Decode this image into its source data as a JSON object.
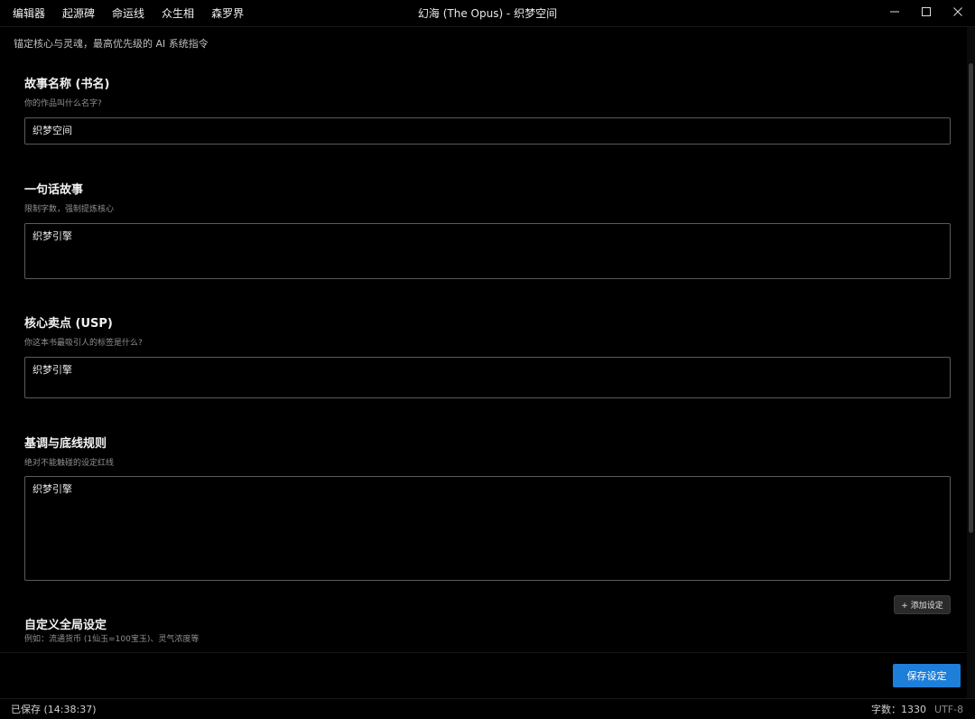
{
  "menu": [
    {
      "label": "编辑器"
    },
    {
      "label": "起源碑"
    },
    {
      "label": "命运线"
    },
    {
      "label": "众生相"
    },
    {
      "label": "森罗界"
    }
  ],
  "window": {
    "title": "幻海 (The Opus) - 织梦空间",
    "minimize_icon": "minimize-icon",
    "maximize_icon": "maximize-icon",
    "close_icon": "close-icon"
  },
  "page": {
    "subtitle": "锚定核心与灵魂，最高优先级的 AI 系统指令"
  },
  "fields": [
    {
      "title": "故事名称 (书名)",
      "desc": "你的作品叫什么名字?",
      "value": "织梦空间"
    },
    {
      "title": "一句话故事",
      "desc": "限制字数，强制提炼核心",
      "value": "织梦引擎"
    },
    {
      "title": "核心卖点 (USP)",
      "desc": "你这本书最吸引人的标签是什么?",
      "value": "织梦引擎"
    },
    {
      "title": "基调与底线规则",
      "desc": "绝对不能触碰的设定红线",
      "value": "织梦引擎"
    }
  ],
  "custom": {
    "title": "自定义全局设定",
    "desc": "例如：流通货币 (1仙玉=100宝玉)、灵气浓度等",
    "add_label": "+ 添加设定"
  },
  "actions": {
    "save_label": "保存设定"
  },
  "status": {
    "saved": "已保存 (14:38:37)",
    "word_count": "字数：1330",
    "encoding": "UTF-8"
  },
  "colors": {
    "accent": "#1e7fd8",
    "background": "#000000"
  }
}
